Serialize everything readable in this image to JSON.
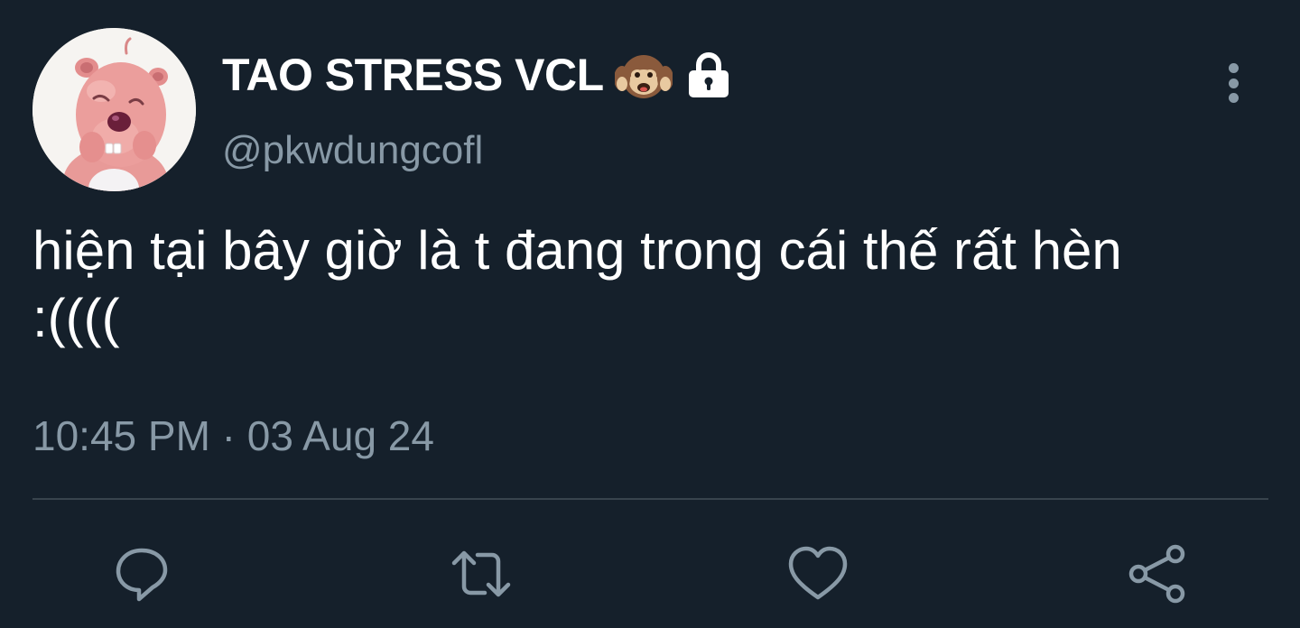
{
  "tweet": {
    "display_name": "TAO STRESS VCL",
    "name_emoji": "hear-no-evil-monkey",
    "protected_icon": "lock-icon",
    "handle": "@pkwdungcofl",
    "text": "hiện tại bây giờ là t đang trong cái thế rất hèn\n:((((",
    "timestamp": "10:45 PM · 03 Aug 24"
  },
  "actions": [
    {
      "name": "reply",
      "icon": "reply-icon"
    },
    {
      "name": "retweet",
      "icon": "retweet-icon"
    },
    {
      "name": "like",
      "icon": "heart-icon"
    },
    {
      "name": "share",
      "icon": "share-icon"
    }
  ],
  "colors": {
    "background": "#15202b",
    "primary_text": "#ffffff",
    "secondary_text": "#8899a6",
    "divider": "#38444d"
  }
}
